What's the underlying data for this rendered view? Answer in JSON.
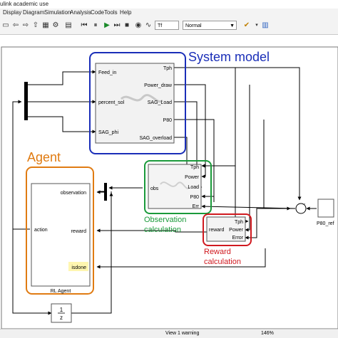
{
  "window": {
    "title": "ulink academic use"
  },
  "menu": [
    "Display",
    "Diagram",
    "Simulation",
    "Analysis",
    "Code",
    "Tools",
    "Help"
  ],
  "toolbar": {
    "stop_time": "Tf",
    "sim_mode": "Normal"
  },
  "diagram": {
    "system_model": {
      "title": "System model",
      "inputs": [
        "Feed_in",
        "percent_sol",
        "SAG_phi"
      ],
      "outputs": [
        "Tph",
        "Power_draw",
        "SAG_Load",
        "P80",
        "SAG_overload"
      ]
    },
    "agent": {
      "title": "Agent",
      "inputs": [
        "observation",
        "reward",
        "isdone"
      ],
      "output": "action",
      "block_label": "RL Agent"
    },
    "observation": {
      "caption_line1": "Observation",
      "caption_line2": "calculation",
      "inputs": [
        "Tph",
        "Power",
        "Load",
        "P80",
        "Err"
      ],
      "output": "obs"
    },
    "reward": {
      "caption_line1": "Reward",
      "caption_line2": "calculation",
      "inputs": [
        "Tph",
        "Power",
        "Error"
      ],
      "output": "reward"
    },
    "reference": {
      "label": "P80_ref",
      "sum_sign": "-"
    },
    "delay": {
      "num": "1",
      "den": "z"
    }
  },
  "colors": {
    "system_model": "#1a2eb8",
    "agent": "#e07b12",
    "observation": "#1a9a3a",
    "reward": "#d0191f"
  },
  "status": {
    "warning": "View 1 warning",
    "zoom": "146%"
  }
}
